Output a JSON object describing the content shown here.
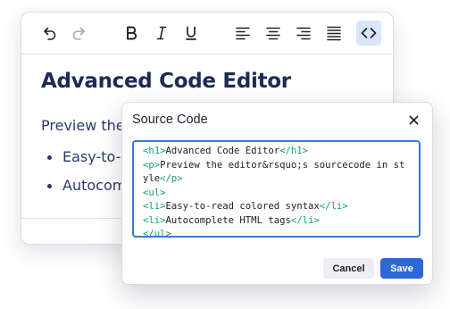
{
  "toolbar": {
    "buttons": [
      {
        "icon": "undo-icon",
        "enabled": true
      },
      {
        "icon": "redo-icon",
        "enabled": false
      },
      {
        "icon": "bold-icon"
      },
      {
        "icon": "italic-icon"
      },
      {
        "icon": "underline-icon"
      },
      {
        "icon": "align-left-icon"
      },
      {
        "icon": "align-center-icon"
      },
      {
        "icon": "align-right-icon"
      },
      {
        "icon": "justify-icon"
      },
      {
        "icon": "source-code-icon",
        "active": true
      }
    ]
  },
  "content": {
    "heading": "Advanced Code Editor",
    "paragraph": "Preview the",
    "list_items": [
      "Easy-to-",
      "Autocom"
    ]
  },
  "dialog": {
    "title": "Source Code",
    "close_icon": "close-icon",
    "code_lines": [
      [
        "<h1>",
        "Advanced Code Editor",
        "</h1>"
      ],
      [
        "<p>",
        "Preview the editor&rsquo;s sourcecode in style",
        "</p>"
      ],
      [
        "<ul>",
        "",
        ""
      ],
      [
        "<li>",
        "Easy-to-read colored syntax",
        "</li>"
      ],
      [
        "<li>",
        "Autocomplete HTML tags",
        "</li>"
      ],
      [
        "</ul>",
        "",
        ""
      ]
    ],
    "cancel_label": "Cancel",
    "save_label": "Save"
  },
  "colors": {
    "text_dark": "#1d2b56",
    "accent": "#2f66d8",
    "focus_border": "#3e75d6",
    "code_tag": "#11a27a",
    "active_tool_bg": "#dbe6fb"
  }
}
